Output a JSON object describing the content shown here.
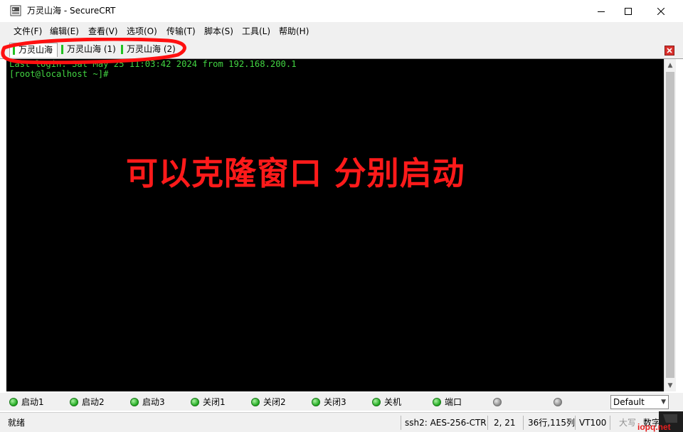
{
  "window": {
    "title": "万灵山海 - SecureCRT"
  },
  "menu": {
    "items": [
      "文件(F)",
      "编辑(E)",
      "查看(V)",
      "选项(O)",
      "传输(T)",
      "脚本(S)",
      "工具(L)",
      "帮助(H)"
    ]
  },
  "tabs": {
    "items": [
      "万灵山海",
      "万灵山海 (1)",
      "万灵山海 (2)"
    ],
    "active_index": 0
  },
  "terminal": {
    "lines": [
      "Last login: Sat May 25 11:03:42 2024 from 192.168.200.1",
      "[root@localhost ~]#"
    ],
    "overlay_text": "可以克隆窗口 分别启动",
    "text_color": "#42d442",
    "overlay_color": "#ff1a1a"
  },
  "command_buttons": {
    "items": [
      "启动1",
      "启动2",
      "启动3",
      "关闭1",
      "关闭2",
      "关闭3",
      "关机",
      "端口",
      "",
      ""
    ]
  },
  "session_select": {
    "value": "Default"
  },
  "status": {
    "ready": "就绪",
    "cipher": "ssh2: AES-256-CTR",
    "cursor": "2,  21",
    "size": "36行,115列",
    "terminal_type": "VT100",
    "caps": "大写",
    "num": "数字"
  },
  "watermark": {
    "text": "iopq.net"
  }
}
